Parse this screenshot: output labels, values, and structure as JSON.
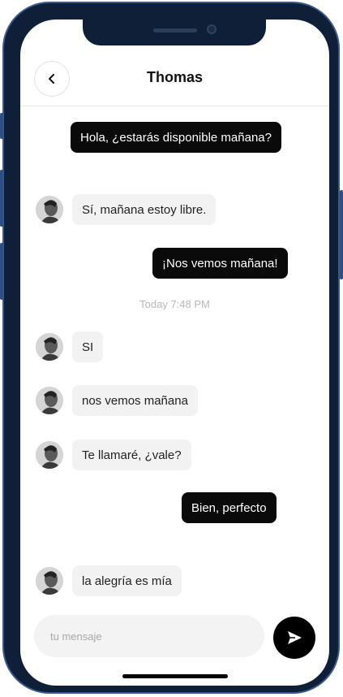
{
  "header": {
    "contact_name": "Thomas",
    "back_icon": "chevron-left-icon"
  },
  "messages": [
    {
      "type": "sent",
      "text": "Hola, ¿estarás disponible mañana?"
    },
    {
      "type": "received",
      "text": "Sí, mañana estoy libre."
    },
    {
      "type": "sent",
      "text": "¡Nos vemos mañana!"
    },
    {
      "type": "received",
      "text": "SI"
    },
    {
      "type": "received",
      "text": "nos vemos mañana"
    },
    {
      "type": "received",
      "text": "Te llamaré, ¿vale?"
    },
    {
      "type": "sent",
      "text": "Bien, perfecto"
    },
    {
      "type": "received",
      "text": "la alegría es mía"
    }
  ],
  "timestamp": "Today 7:48 PM",
  "composer": {
    "placeholder": "tu mensaje",
    "send_icon": "send-icon"
  },
  "colors": {
    "sent_bubble": "#0a0a0a",
    "received_bubble": "#f2f2f2",
    "frame": "#0f1f38"
  }
}
